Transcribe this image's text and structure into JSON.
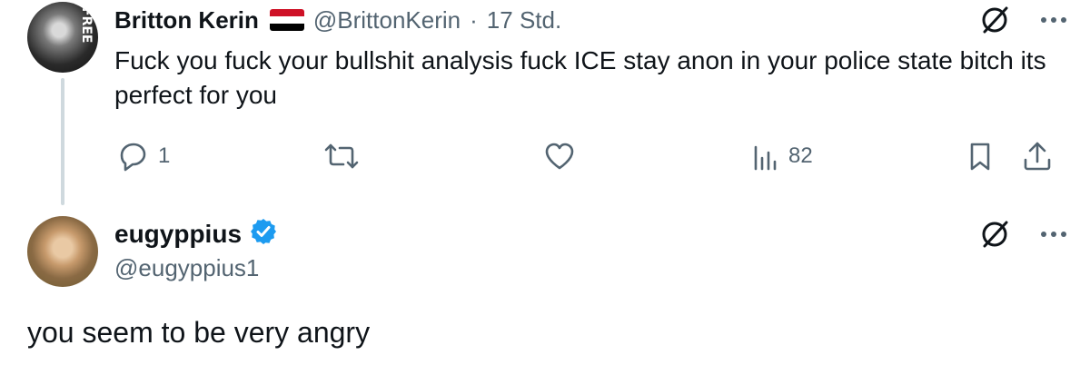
{
  "tweets": [
    {
      "author_name": "Britton Kerin",
      "handle": "@BrittonKerin",
      "separator": "·",
      "time": "17 Std.",
      "flag": "yemen-flag",
      "avatar_text": "FREE",
      "text": "Fuck you fuck your bullshit analysis fuck ICE stay anon in your police state bitch its perfect for you",
      "actions": {
        "reply_count": "1",
        "views_count": "82"
      }
    },
    {
      "author_name": "eugyppius",
      "handle": "@eugyppius1",
      "verified": true,
      "text": "you seem to be very angry"
    }
  ],
  "icons": [
    "grok-icon",
    "more-icon",
    "reply-icon",
    "retweet-icon",
    "like-icon",
    "views-icon",
    "bookmark-icon",
    "share-icon",
    "verified-badge-icon"
  ],
  "colors": {
    "text": "#0f1419",
    "secondary": "#536471",
    "verified": "#1d9bf0",
    "thread_line": "#cfd9de",
    "flag_red": "#ce1126",
    "flag_white": "#ffffff",
    "flag_black": "#000000"
  }
}
